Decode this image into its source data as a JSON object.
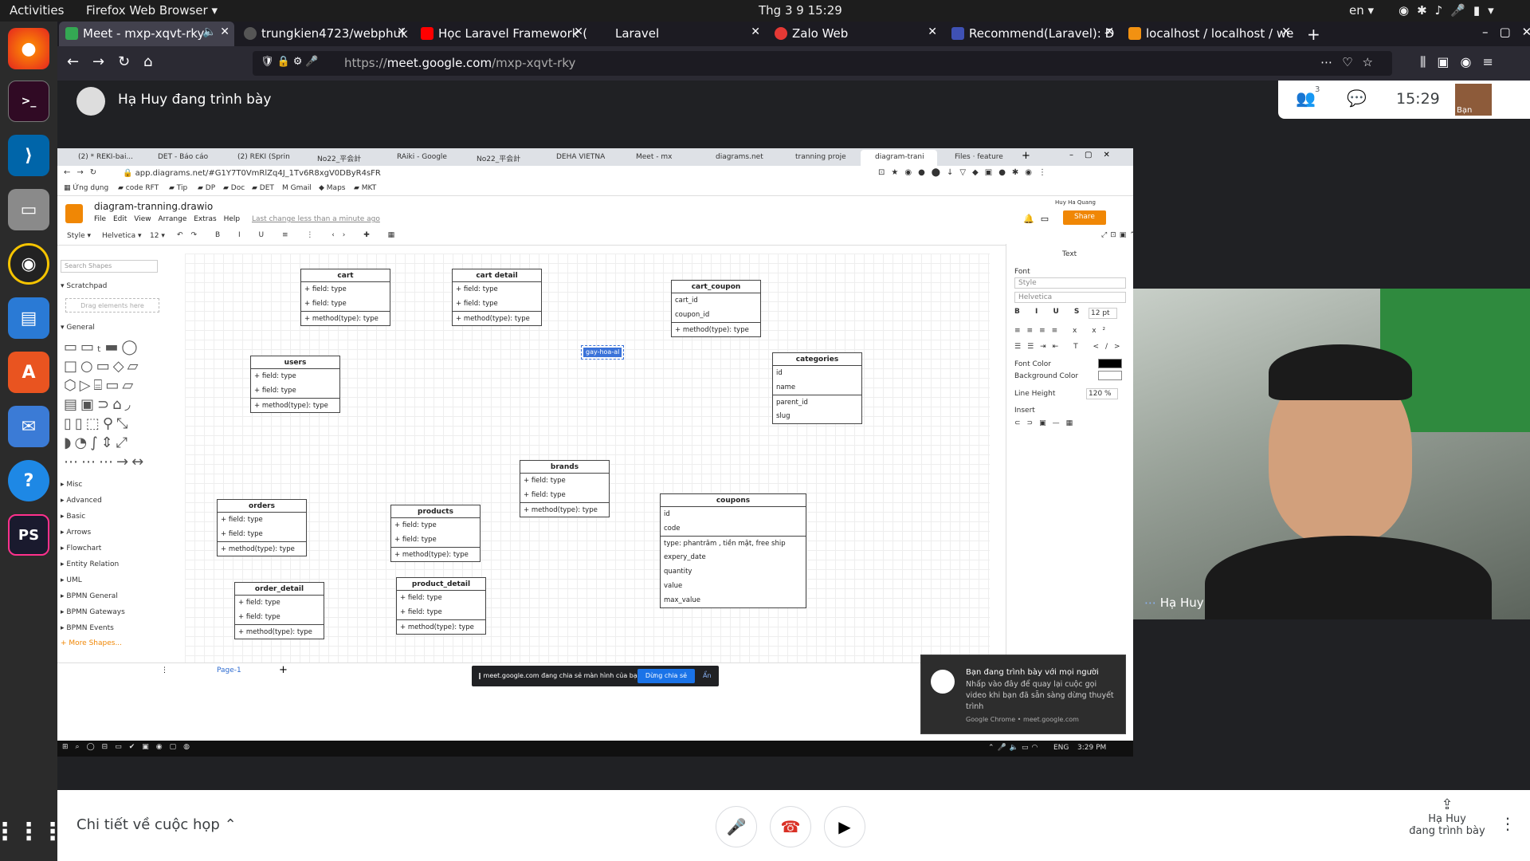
{
  "system": {
    "activities": "Activities",
    "app_menu": "Firefox Web Browser",
    "clock": "Thg 3 9  15:29",
    "lang": "en"
  },
  "firefox": {
    "tabs": [
      {
        "label": "Meet - mxp-xqvt-rky",
        "color": "#34a853"
      },
      {
        "label": "trungkien4723/webphuk",
        "color": "#555"
      },
      {
        "label": "Học Laravel Framework (",
        "color": "#ff0000"
      },
      {
        "label": "Laravel",
        "color": "#ff2d20"
      },
      {
        "label": "Zalo Web",
        "color": "#e53935"
      },
      {
        "label": "Recommend(Laravel): Đ",
        "color": "#3f51b5"
      },
      {
        "label": "localhost / localhost / we",
        "color": "#f29111"
      }
    ],
    "url_proto": "https://",
    "url_host": "meet.google.com",
    "url_path": "/mxp-xqvt-rky"
  },
  "meet": {
    "presenter_text": "Hạ Huy đang trình bày",
    "participants_count": "3",
    "time": "15:29",
    "self_label": "Bạn",
    "camera_name": "Hạ Huy",
    "notif_title": "Bạn đang trình bày với mọi người",
    "notif_body": "Nhấp vào đây để quay lại cuộc gọi video khi bạn đã sẵn sàng dừng thuyết trình",
    "notif_source": "Google Chrome • meet.google.com",
    "share_bar_text": "meet.google.com đang chia sẻ màn hình của bạn.",
    "share_stop": "Dừng chia sẻ",
    "share_hide": "Ẩn",
    "details": "Chi tiết về cuộc họp",
    "presenting_name": "Hạ Huy",
    "presenting_sub": "đang trình bày"
  },
  "chrome": {
    "tabs": [
      "(2) * REKI-bai...",
      "DET - Báo cáo",
      "(2) REKI (Sprin",
      "No22_平会計",
      "RAiki - Google",
      "No22_平会計",
      "DEHA VIETNA",
      "Meet - mx",
      "diagrams.net",
      "tranning proje",
      "diagram-trani",
      "Files · feature"
    ],
    "url": "app.diagrams.net/#G1Y7T0VmRlZq4J_1Tv6R8xgV0DByR4sFR",
    "bookmarks": [
      "Ứng dụng",
      "code RFT",
      "Tip",
      "DP",
      "Doc",
      "DET",
      "Gmail",
      "Maps",
      "MKT"
    ]
  },
  "drawio": {
    "title": "diagram-tranning.drawio",
    "menu": [
      "File",
      "Edit",
      "View",
      "Arrange",
      "Extras",
      "Help"
    ],
    "last_change": "Last change less than a minute ago",
    "user": "Huy Ha Quang",
    "share": "Share",
    "toolbar": {
      "style": "Style",
      "font": "Helvetica",
      "size": "12"
    },
    "search": "Search Shapes",
    "scratchpad": "Scratchpad",
    "drag_hint": "Drag elements here",
    "general": "General",
    "libs": [
      "Misc",
      "Advanced",
      "Basic",
      "Arrows",
      "Flowchart",
      "Entity Relation",
      "UML",
      "BPMN General",
      "BPMN Gateways",
      "BPMN Events"
    ],
    "more_shapes": "+ More Shapes...",
    "page_tab": "Page-1",
    "selected_text": "gay-hoa-al",
    "panel": {
      "heading": "Text",
      "font": "Font",
      "style": "Style",
      "fontname": "Helvetica",
      "fontsize": "12 pt",
      "font_color": "Font Color",
      "bg_color": "Background Color",
      "line_height": "Line Height",
      "lh_value": "120 %",
      "insert": "Insert"
    }
  },
  "entities": {
    "cart": {
      "title": "cart",
      "rows": [
        "+ field: type",
        "+ field: type"
      ],
      "method": "+ method(type): type"
    },
    "cart_detail": {
      "title": "cart detail",
      "rows": [
        "+ field: type",
        "+ field: type"
      ],
      "method": "+ method(type): type"
    },
    "cart_coupon": {
      "title": "cart_coupon",
      "rows": [
        "cart_id",
        "coupon_id"
      ],
      "method": "+ method(type): type"
    },
    "users": {
      "title": "users",
      "rows": [
        "+ field: type",
        "+ field: type"
      ],
      "method": "+ method(type): type"
    },
    "categories": {
      "title": "categories",
      "rows": [
        "id",
        "name"
      ],
      "rows2": [
        "parent_id",
        "slug"
      ]
    },
    "brands": {
      "title": "brands",
      "rows": [
        "+ field: type",
        "+ field: type"
      ],
      "method": "+ method(type): type"
    },
    "orders": {
      "title": "orders",
      "rows": [
        "+ field: type",
        "+ field: type"
      ],
      "method": "+ method(type): type"
    },
    "products": {
      "title": "products",
      "rows": [
        "+ field: type",
        "+ field: type"
      ],
      "method": "+ method(type): type"
    },
    "coupons": {
      "title": "coupons",
      "rows": [
        "id",
        "code"
      ],
      "rows2": [
        "type: phantrăm , tiền mặt, free ship",
        "expery_date",
        "quantity",
        "value",
        "max_value"
      ]
    },
    "order_detail": {
      "title": "order_detail",
      "rows": [
        "+ field: type",
        "+ field: type"
      ],
      "method": "+ method(type): type"
    },
    "product_detail": {
      "title": "product_detail",
      "rows": [
        "+ field: type",
        "+ field: type"
      ],
      "method": "+ method(type): type"
    }
  },
  "win_taskbar": {
    "lang": "ENG",
    "time": "3:29 PM"
  }
}
